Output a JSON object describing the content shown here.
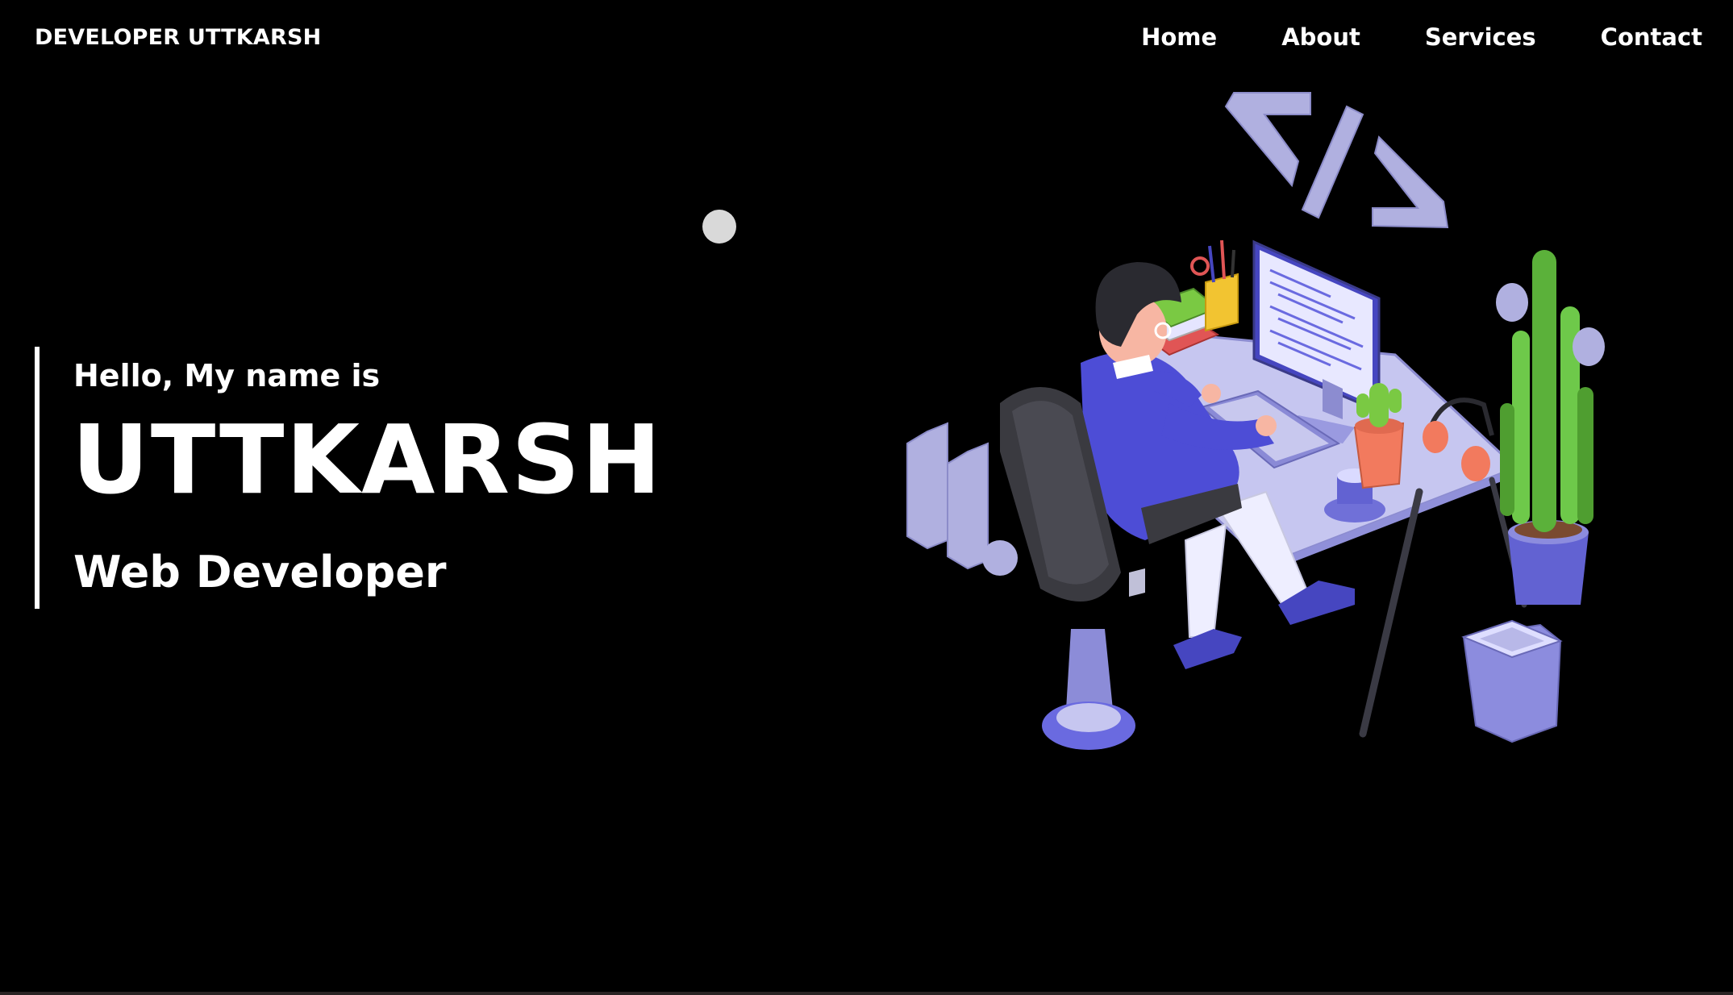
{
  "navbar": {
    "brand": "DEVELOPER UTTKARSH",
    "links": [
      {
        "label": "Home"
      },
      {
        "label": "About"
      },
      {
        "label": "Services"
      },
      {
        "label": "Contact"
      }
    ]
  },
  "hero": {
    "greeting": "Hello, My name is",
    "name": "UTTKARSH",
    "role": "Web Developer"
  },
  "illustration": {
    "icon": "developer-at-desk-illustration",
    "code_symbol": "</>"
  },
  "colors": {
    "background": "#000000",
    "text": "#ffffff",
    "accent_lavender": "#b3b3e6",
    "accent_blue": "#5a5ae6",
    "plant_green": "#4caf50"
  }
}
